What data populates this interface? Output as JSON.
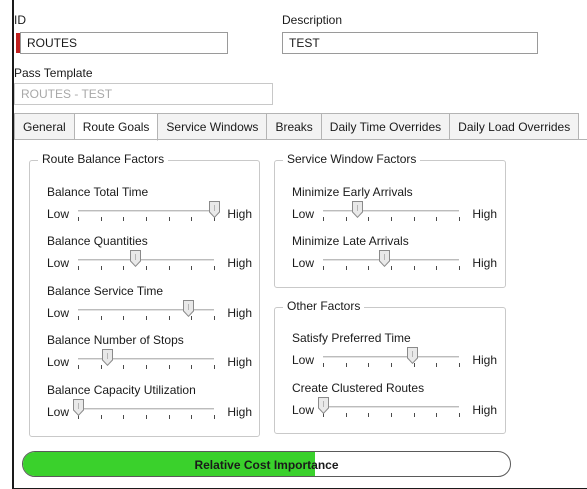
{
  "header": {
    "id_label": "ID",
    "id_value": "ROUTES",
    "description_label": "Description",
    "description_value": "TEST",
    "pass_template_label": "Pass Template",
    "pass_template_value": "ROUTES - TEST"
  },
  "tabs": [
    {
      "label": "General",
      "active": false
    },
    {
      "label": "Route Goals",
      "active": true
    },
    {
      "label": "Service Windows",
      "active": false
    },
    {
      "label": "Breaks",
      "active": false
    },
    {
      "label": "Daily Time Overrides",
      "active": false
    },
    {
      "label": "Daily Load Overrides",
      "active": false
    }
  ],
  "slider_scale": {
    "low": "Low",
    "high": "High",
    "ticks": 7
  },
  "groups": {
    "route_balance": {
      "title": "Route Balance Factors",
      "sliders": [
        {
          "label": "Balance Total Time",
          "value": 1.0
        },
        {
          "label": "Balance Quantities",
          "value": 0.42
        },
        {
          "label": "Balance Service Time",
          "value": 0.81
        },
        {
          "label": "Balance Number of Stops",
          "value": 0.22
        },
        {
          "label": "Balance Capacity Utilization",
          "value": 0.0
        }
      ]
    },
    "service_window": {
      "title": "Service Window Factors",
      "sliders": [
        {
          "label": "Minimize Early Arrivals",
          "value": 0.25
        },
        {
          "label": "Minimize Late Arrivals",
          "value": 0.45
        }
      ]
    },
    "other": {
      "title": "Other Factors",
      "sliders": [
        {
          "label": "Satisfy Preferred Time",
          "value": 0.66
        },
        {
          "label": "Create Clustered Routes",
          "value": 0.0
        }
      ]
    }
  },
  "relative_cost": {
    "label": "Relative Cost Importance",
    "value": 0.6
  },
  "colors": {
    "required": "#c0201f",
    "progress": "#3ad12c"
  }
}
